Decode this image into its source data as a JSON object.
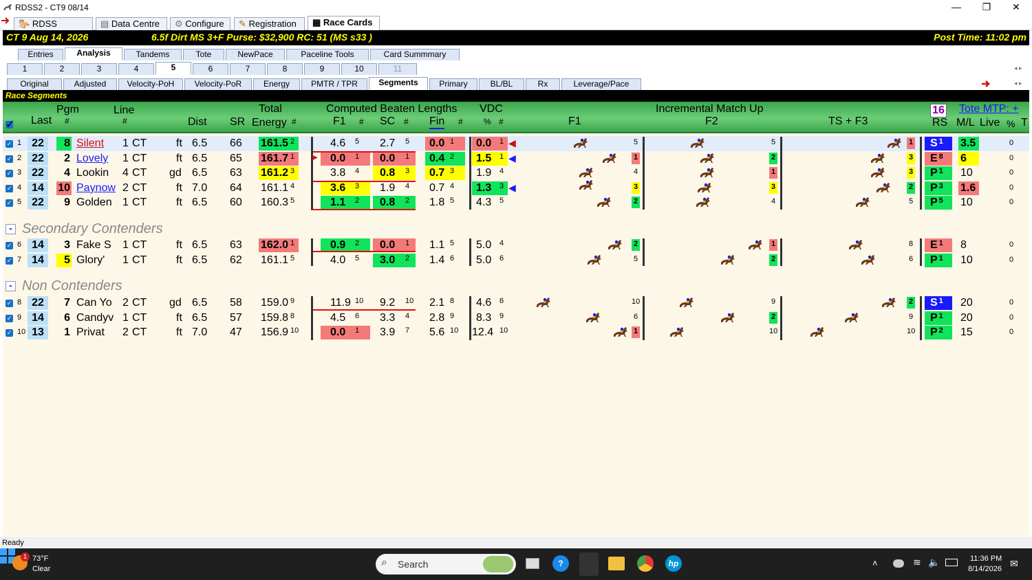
{
  "window": {
    "title": "RDSS2 - CT9  08/14",
    "controls": [
      "—",
      "❐",
      "✕"
    ]
  },
  "main_tabs": [
    {
      "label": "RDSS Desktop",
      "icon": "horse-icon"
    },
    {
      "label": "Data Centre",
      "icon": "database-icon"
    },
    {
      "label": "Configure",
      "icon": "gear-icon"
    },
    {
      "label": "Registration",
      "icon": "key-icon"
    },
    {
      "label": "Race Cards",
      "icon": "card-icon",
      "active": true
    }
  ],
  "race_info": {
    "track": "CT  9   Aug 14, 2026",
    "conditions": "6.5f  Dirt   MS  3+F   Purse: $32,900   RC: 51  (MS s33 )",
    "post_time": "Post Time: 11:02 pm"
  },
  "view_tabs": [
    "Entries",
    "Analysis",
    "Tandems",
    "Tote",
    "NewPace",
    "Paceline Tools",
    "Card Summmary"
  ],
  "view_active": "Analysis",
  "race_tabs": [
    "1",
    "2",
    "3",
    "4",
    "5",
    "6",
    "7",
    "8",
    "9",
    "10",
    "11"
  ],
  "race_active": "5",
  "sub_tabs": [
    "Original",
    "Adjusted",
    "Velocity-PoH",
    "Velocity-PoR",
    "Energy",
    "PMTR / TPR",
    "Segments",
    "Primary",
    "BL/BL",
    "Rx",
    "Leverage/Pace"
  ],
  "sub_active": "Segments",
  "section_title": "Race Segments",
  "header": {
    "pgm": "Pgm",
    "pgm_hash": "#",
    "last": "Last",
    "line": "Line",
    "line_hash": "#",
    "dist": "Dist",
    "sr": "SR",
    "total": "Total",
    "energy": "Energy",
    "energy_hash": "#",
    "cbl": "Computed Beaten Lengths",
    "f1": "F1",
    "f1_hash": "#",
    "sc": "SC",
    "sc_hash": "#",
    "fin": "Fin",
    "fin_hash": "#",
    "vdc": "VDC",
    "vdc_pct": "%",
    "vdc_hash": "#",
    "f1m": "F1",
    "imu": "Incremental Match Up",
    "f2": "F2",
    "tsf3": "TS + F3",
    "count": "16",
    "tote": "Tote MTP: +",
    "rs": "RS",
    "ml": "M/L",
    "live": "Live",
    "pct": "%",
    "t": "T"
  },
  "sections": {
    "secondary": "Secondary Contenders",
    "non": "Non Contenders",
    "btn": "-"
  },
  "rows": [
    {
      "n": "1",
      "last": "22",
      "pgm": "8",
      "name": "Silent",
      "line": "1",
      "trk": "CT",
      "cond": "ft",
      "dist": "6.5",
      "sr": "66",
      "energy": "161.5",
      "er": "2",
      "f1": "4.6",
      "f1r": "5",
      "sc": "2.7",
      "scr": "5",
      "fin": "0.0",
      "finr": "1",
      "vdc": "0.0",
      "vdcr": "1",
      "h1": "",
      "h2": "5",
      "h3": "",
      "h4": "5",
      "h5": "",
      "h6": "1",
      "rs": "S",
      "rsn": "1",
      "ml": "3.5",
      "live": "0"
    },
    {
      "n": "2",
      "last": "22",
      "pgm": "2",
      "name": "Lovely",
      "line": "1",
      "trk": "CT",
      "cond": "ft",
      "dist": "6.5",
      "sr": "65",
      "energy": "161.7",
      "er": "1",
      "f1": "0.0",
      "f1r": "1",
      "sc": "0.0",
      "scr": "1",
      "fin": "0.4",
      "finr": "2",
      "vdc": "1.5",
      "vdcr": "1",
      "h1": "",
      "h2": "1",
      "h3": "",
      "h4": "2",
      "h5": "",
      "h6": "3",
      "rs": "E",
      "rsn": "8",
      "ml": "6",
      "live": "0"
    },
    {
      "n": "3",
      "last": "22",
      "pgm": "4",
      "name": "Lookin",
      "line": "4",
      "trk": "CT",
      "cond": "gd",
      "dist": "6.5",
      "sr": "63",
      "energy": "161.2",
      "er": "3",
      "f1": "3.8",
      "f1r": "4",
      "sc": "0.8",
      "scr": "3",
      "fin": "0.7",
      "finr": "3",
      "vdc": "1.9",
      "vdcr": "4",
      "h1": "",
      "h2": "4",
      "h3": "",
      "h4": "1",
      "h5": "",
      "h6": "3",
      "rs": "P",
      "rsn": "1",
      "ml": "10",
      "live": "0"
    },
    {
      "n": "4",
      "last": "14",
      "pgm": "10",
      "name": "Paynow",
      "line": "2",
      "trk": "CT",
      "cond": "ft",
      "dist": "7.0",
      "sr": "64",
      "energy": "161.1",
      "er": "4",
      "f1": "3.6",
      "f1r": "3",
      "sc": "1.9",
      "scr": "4",
      "fin": "0.7",
      "finr": "4",
      "vdc": "1.3",
      "vdcr": "3",
      "h1": "",
      "h2": "3",
      "h3": "",
      "h4": "3",
      "h5": "",
      "h6": "2",
      "rs": "P",
      "rsn": "3",
      "ml": "1.6",
      "live": "0"
    },
    {
      "n": "5",
      "last": "22",
      "pgm": "9",
      "name": "Golden",
      "line": "1",
      "trk": "CT",
      "cond": "ft",
      "dist": "6.5",
      "sr": "60",
      "energy": "160.3",
      "er": "5",
      "f1": "1.1",
      "f1r": "2",
      "sc": "0.8",
      "scr": "2",
      "fin": "1.8",
      "finr": "5",
      "vdc": "4.3",
      "vdcr": "5",
      "h1": "",
      "h2": "2",
      "h3": "",
      "h4": "4",
      "h5": "",
      "h6": "5",
      "rs": "P",
      "rsn": "5",
      "ml": "10",
      "live": "0"
    },
    {
      "n": "6",
      "last": "14",
      "pgm": "3",
      "name": "Fake S",
      "line": "1",
      "trk": "CT",
      "cond": "ft",
      "dist": "6.5",
      "sr": "63",
      "energy": "162.0",
      "er": "1",
      "f1": "0.9",
      "f1r": "2",
      "sc": "0.0",
      "scr": "1",
      "fin": "1.1",
      "finr": "5",
      "vdc": "5.0",
      "vdcr": "4",
      "h1": "",
      "h2": "2",
      "h3": "",
      "h4": "1",
      "h5": "",
      "h6": "8",
      "rs": "E",
      "rsn": "1",
      "ml": "8",
      "live": "0"
    },
    {
      "n": "7",
      "last": "14",
      "pgm": "5",
      "name": "Glory'",
      "line": "1",
      "trk": "CT",
      "cond": "ft",
      "dist": "6.5",
      "sr": "62",
      "energy": "161.1",
      "er": "5",
      "f1": "4.0",
      "f1r": "5",
      "sc": "3.0",
      "scr": "2",
      "fin": "1.4",
      "finr": "6",
      "vdc": "5.0",
      "vdcr": "6",
      "h1": "",
      "h2": "5",
      "h3": "",
      "h4": "2",
      "h5": "",
      "h6": "6",
      "rs": "P",
      "rsn": "1",
      "ml": "10",
      "live": "0"
    },
    {
      "n": "8",
      "last": "22",
      "pgm": "7",
      "name": "Can Yo",
      "line": "2",
      "trk": "CT",
      "cond": "gd",
      "dist": "6.5",
      "sr": "58",
      "energy": "159.0",
      "er": "9",
      "f1": "11.9",
      "f1r": "10",
      "sc": "9.2",
      "scr": "10",
      "fin": "2.1",
      "finr": "8",
      "vdc": "4.6",
      "vdcr": "6",
      "h1": "",
      "h2": "10",
      "h3": "",
      "h4": "9",
      "h5": "",
      "h6": "2",
      "rs": "S",
      "rsn": "1",
      "ml": "20",
      "live": "0"
    },
    {
      "n": "9",
      "last": "14",
      "pgm": "6",
      "name": "Candyv",
      "line": "1",
      "trk": "CT",
      "cond": "ft",
      "dist": "6.5",
      "sr": "57",
      "energy": "159.8",
      "er": "8",
      "f1": "4.5",
      "f1r": "6",
      "sc": "3.3",
      "scr": "4",
      "fin": "2.8",
      "finr": "9",
      "vdc": "8.3",
      "vdcr": "9",
      "h1": "",
      "h2": "6",
      "h3": "",
      "h4": "2",
      "h5": "",
      "h6": "9",
      "rs": "P",
      "rsn": "1",
      "ml": "20",
      "live": "0"
    },
    {
      "n": "10",
      "last": "13",
      "pgm": "1",
      "name": "Privat",
      "line": "2",
      "trk": "CT",
      "cond": "ft",
      "dist": "7.0",
      "sr": "47",
      "energy": "156.9",
      "er": "10",
      "f1": "0.0",
      "f1r": "1",
      "sc": "3.9",
      "scr": "7",
      "fin": "5.6",
      "finr": "10",
      "vdc": "12.4",
      "vdcr": "10",
      "h1": "",
      "h2": "1",
      "h3": "",
      "h4": "10",
      "h5": "",
      "h6": "10",
      "rs": "P",
      "rsn": "2",
      "ml": "15",
      "live": "0"
    }
  ],
  "status": "Ready",
  "taskbar": {
    "temp": "73°F",
    "weather": "Clear",
    "badge": "1",
    "search": "Search",
    "time": "11:36 PM",
    "date": "8/14/2026"
  }
}
